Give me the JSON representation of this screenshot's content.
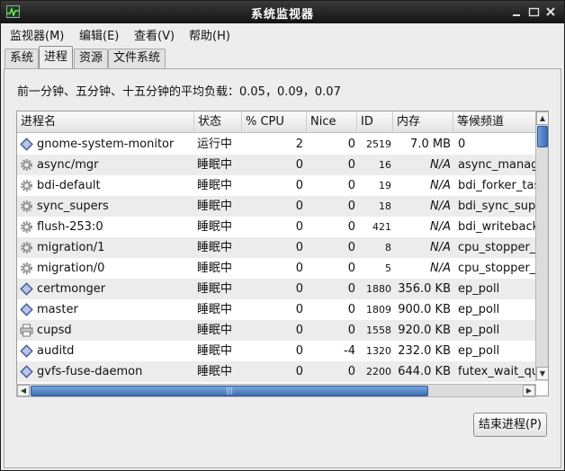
{
  "window": {
    "title": "系统监视器"
  },
  "menu": [
    "监视器(M)",
    "编辑(E)",
    "查看(V)",
    "帮助(H)"
  ],
  "tabs": [
    "系统",
    "进程",
    "资源",
    "文件系统"
  ],
  "active_tab": 1,
  "load_avg": "前一分钟、五分钟、十五分钟的平均负载：0.05，0.09，0.07",
  "columns": [
    "进程名",
    "状态",
    "% CPU",
    "Nice",
    "ID",
    "内存",
    "等候频道"
  ],
  "processes": [
    {
      "name": "gnome-system-monitor",
      "icon": "diamond-icon",
      "state": "运行中",
      "cpu": "2",
      "nice": "0",
      "id": "2519",
      "mem": "7.0 MB",
      "wchan": "0"
    },
    {
      "name": "async/mgr",
      "icon": "gear-icon",
      "state": "睡眠中",
      "cpu": "0",
      "nice": "0",
      "id": "16",
      "mem": "N/A",
      "wchan": "async_manager"
    },
    {
      "name": "bdi-default",
      "icon": "gear-icon",
      "state": "睡眠中",
      "cpu": "0",
      "nice": "0",
      "id": "19",
      "mem": "N/A",
      "wchan": "bdi_forker_task"
    },
    {
      "name": "sync_supers",
      "icon": "gear-icon",
      "state": "睡眠中",
      "cpu": "0",
      "nice": "0",
      "id": "18",
      "mem": "N/A",
      "wchan": "bdi_sync_supers"
    },
    {
      "name": "flush-253:0",
      "icon": "gear-icon",
      "state": "睡眠中",
      "cpu": "0",
      "nice": "0",
      "id": "421",
      "mem": "N/A",
      "wchan": "bdi_writeback"
    },
    {
      "name": "migration/1",
      "icon": "gear-icon",
      "state": "睡眠中",
      "cpu": "0",
      "nice": "0",
      "id": "8",
      "mem": "N/A",
      "wchan": "cpu_stopper_thread"
    },
    {
      "name": "migration/0",
      "icon": "gear-icon",
      "state": "睡眠中",
      "cpu": "0",
      "nice": "0",
      "id": "5",
      "mem": "N/A",
      "wchan": "cpu_stopper_thread"
    },
    {
      "name": "certmonger",
      "icon": "diamond-icon",
      "state": "睡眠中",
      "cpu": "0",
      "nice": "0",
      "id": "1880",
      "mem": "356.0 KB",
      "wchan": "ep_poll"
    },
    {
      "name": "master",
      "icon": "diamond-icon",
      "state": "睡眠中",
      "cpu": "0",
      "nice": "0",
      "id": "1809",
      "mem": "900.0 KB",
      "wchan": "ep_poll"
    },
    {
      "name": "cupsd",
      "icon": "printer-icon",
      "state": "睡眠中",
      "cpu": "0",
      "nice": "0",
      "id": "1558",
      "mem": "920.0 KB",
      "wchan": "ep_poll"
    },
    {
      "name": "auditd",
      "icon": "diamond-icon",
      "state": "睡眠中",
      "cpu": "0",
      "nice": "-4",
      "id": "1320",
      "mem": "232.0 KB",
      "wchan": "ep_poll"
    },
    {
      "name": "gvfs-fuse-daemon",
      "icon": "diamond-icon",
      "state": "睡眠中",
      "cpu": "0",
      "nice": "0",
      "id": "2200",
      "mem": "644.0 KB",
      "wchan": "futex_wait_queue_me"
    }
  ],
  "end_process_label": "结束进程(P)",
  "colors": {
    "accent": "#3d6eb3",
    "titlebar": "#1e1e1e"
  }
}
